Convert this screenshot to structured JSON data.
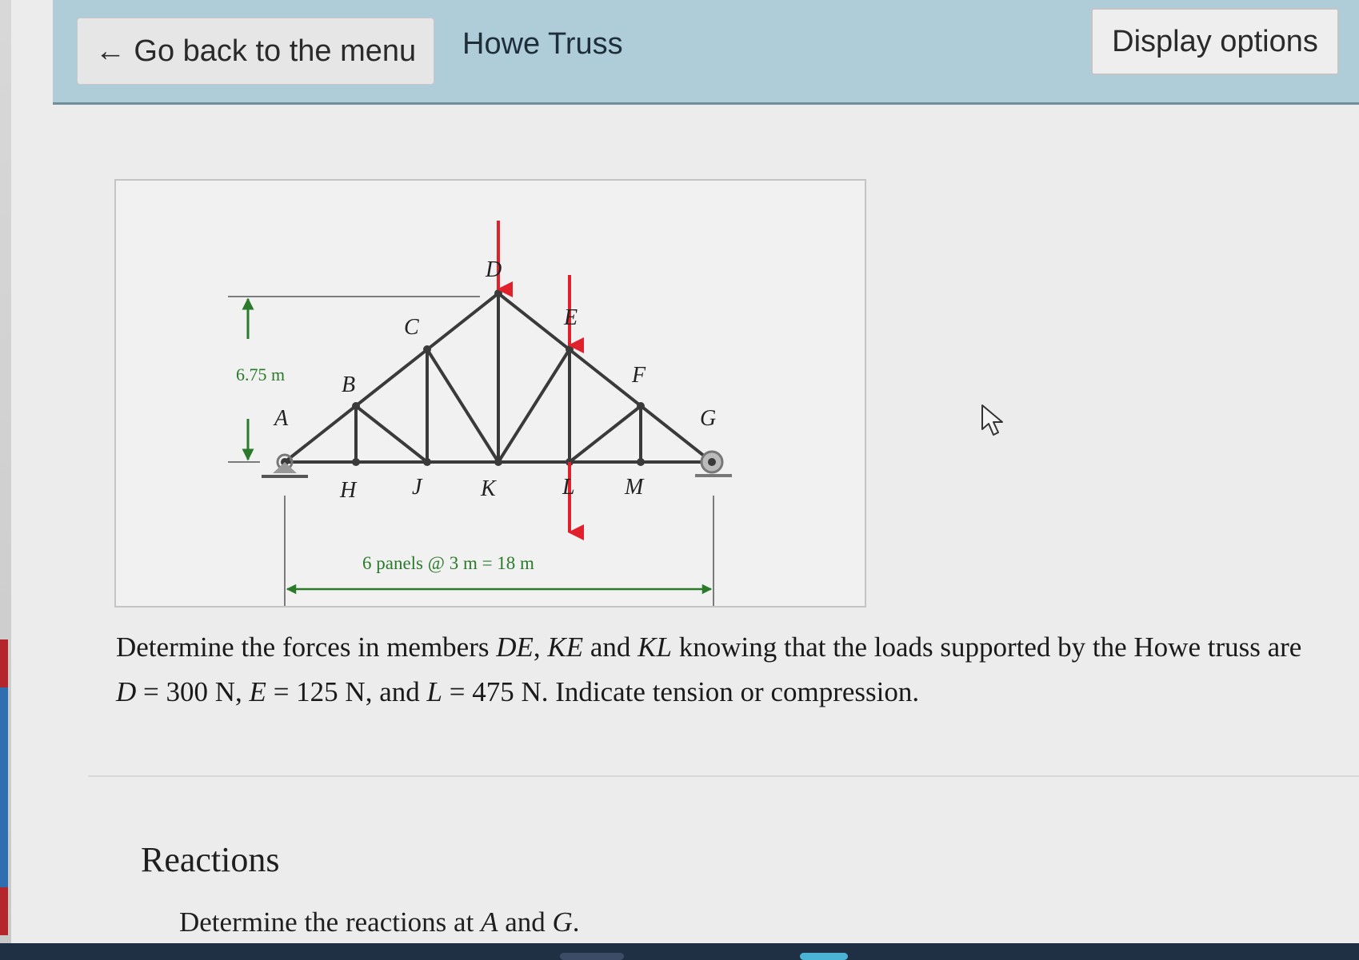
{
  "header": {
    "back_button": "← Go back to the menu",
    "title": "Howe Truss",
    "display_options": "Display options"
  },
  "figure": {
    "height_label": "6.75 m",
    "span_label": "6 panels @ 3 m = 18 m",
    "nodes": {
      "A": "A",
      "B": "B",
      "C": "C",
      "D": "D",
      "E": "E",
      "F": "F",
      "G": "G",
      "H": "H",
      "J": "J",
      "K": "K",
      "L": "L",
      "M": "M"
    },
    "colors": {
      "member": "#3a3a3a",
      "load": "#e0202a",
      "dimension": "#2b7a2b"
    }
  },
  "problem": {
    "p1": "Determine the forces in members ",
    "m1": "DE",
    "p2": ", ",
    "m2": "KE",
    "p3": " and ",
    "m3": "KL",
    "p4": " knowing that the loads supported by the Howe truss are ",
    "v1": "D",
    "p5": " = 300 N, ",
    "v2": "E",
    "p6": " = 125 N, and ",
    "v3": "L",
    "p7": " = 475 N. Indicate tension or compression."
  },
  "reactions": {
    "title": "Reactions",
    "task_prefix": "Determine the reactions at ",
    "a": "A",
    "and": " and ",
    "g": "G",
    "end": "."
  }
}
